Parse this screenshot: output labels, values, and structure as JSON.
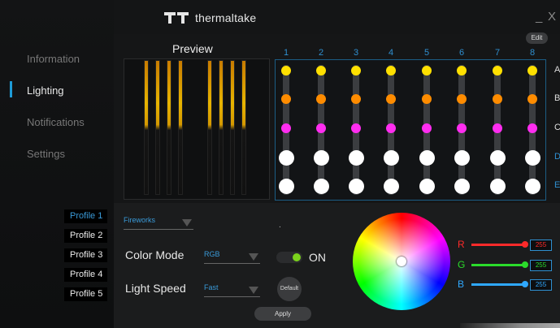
{
  "header": {
    "brand": "thermaltake",
    "minimize_icon": "_",
    "close_icon": "X",
    "edit_label": "Edit"
  },
  "sidebar": {
    "items": [
      {
        "label": "Information",
        "active": false
      },
      {
        "label": "Lighting",
        "active": true
      },
      {
        "label": "Notifications",
        "active": false
      },
      {
        "label": "Settings",
        "active": false
      }
    ]
  },
  "preview": {
    "title": "Preview"
  },
  "matrix": {
    "columns": [
      "1",
      "2",
      "3",
      "4",
      "5",
      "6",
      "7",
      "8"
    ],
    "rows": [
      {
        "label": "A",
        "color": "#ffe000"
      },
      {
        "label": "B",
        "color": "#ff8c00"
      },
      {
        "label": "C",
        "color": "#ff2df0"
      },
      {
        "label": "D",
        "color": "#ffffff"
      },
      {
        "label": "E",
        "color": "#ffffff"
      }
    ]
  },
  "profiles": {
    "items": [
      "Profile 1",
      "Profile 2",
      "Profile 3",
      "Profile 4",
      "Profile 5"
    ],
    "active_index": 0
  },
  "effect": {
    "value": "Fireworks"
  },
  "color_mode": {
    "label": "Color Mode",
    "value": "RGB"
  },
  "light_speed": {
    "label": "Light Speed",
    "value": "Fast"
  },
  "power": {
    "dot": ".",
    "state": "ON"
  },
  "buttons": {
    "default": "Default",
    "apply": "Apply"
  },
  "channels": [
    {
      "label": "R",
      "value": "255",
      "color": "#ff2a2a"
    },
    {
      "label": "G",
      "value": "255",
      "color": "#2bdc2b"
    },
    {
      "label": "B",
      "value": "255",
      "color": "#2fa8ff"
    }
  ],
  "colors": {
    "accent": "#1e9bd7",
    "toggle_on": "#7bd21c"
  }
}
